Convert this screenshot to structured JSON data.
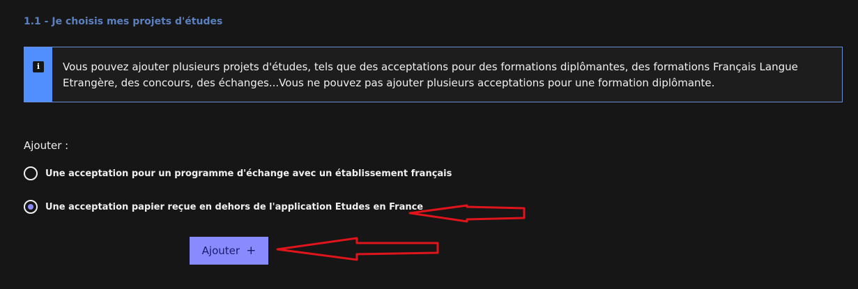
{
  "section": {
    "title": "1.1 - Je choisis mes projets d'études"
  },
  "info": {
    "icon": "info-icon",
    "icon_glyph": "i",
    "text": "Vous pouvez ajouter plusieurs projets d'études, tels que des acceptations pour des formations diplômantes, des formations Français Langue Etrangère, des concours, des échanges...Vous ne pouvez pas ajouter plusieurs acceptations pour une formation diplômante."
  },
  "form": {
    "add_label": "Ajouter :",
    "options": [
      {
        "label": "Une acceptation pour un programme d'échange avec un établissement français",
        "checked": false
      },
      {
        "label": "Une acceptation papier reçue en dehors de l'application Etudes en France",
        "checked": true
      }
    ],
    "button_label": "Ajouter",
    "button_icon": "plus-icon",
    "button_icon_glyph": "+"
  },
  "colors": {
    "background": "#161616",
    "title": "#5b80bf",
    "info_accent": "#518fff",
    "button": "#8a8aff",
    "annotation_arrow": "#e0151b"
  }
}
